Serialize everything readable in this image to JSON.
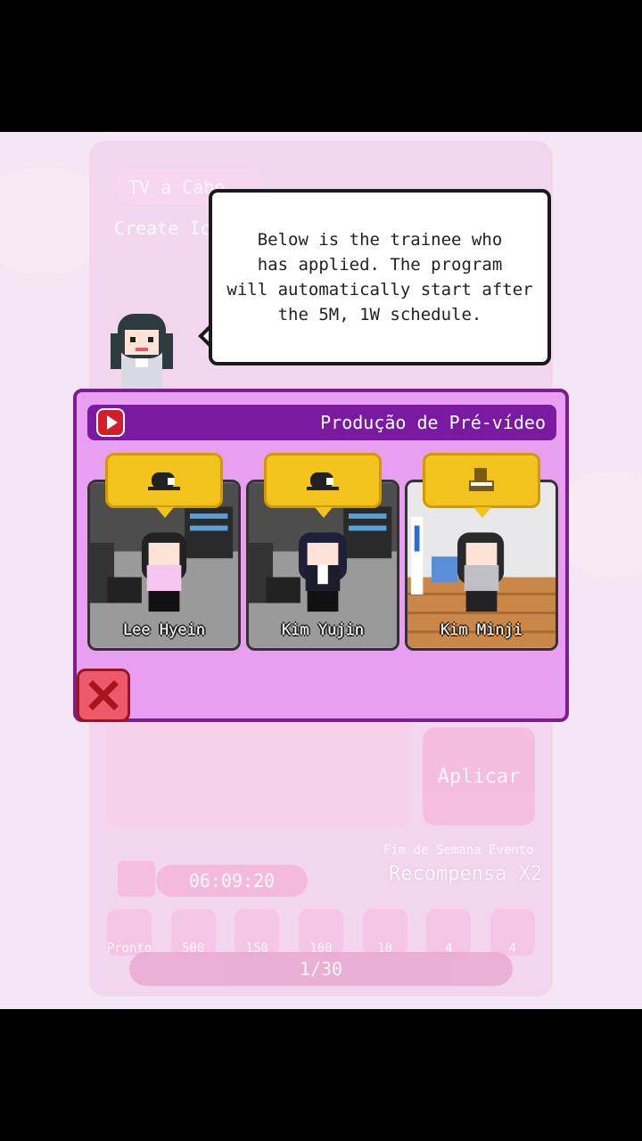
{
  "background": {
    "tv_label": "TV a Cabo",
    "subtitle": "Create Ic",
    "apply_button": "Aplicar",
    "event_label": "Fim de Semana Evento",
    "reward_label": "Recompensa X2",
    "timer": "06:09:20",
    "rewards": [
      {
        "label": "Pronto"
      },
      {
        "label": "500"
      },
      {
        "label": "150"
      },
      {
        "label": "100"
      },
      {
        "label": "10"
      },
      {
        "label": "4"
      },
      {
        "label": "4"
      }
    ],
    "progress": "1/30"
  },
  "bubble": {
    "text": "Below is the trainee who\nhas applied. The program\nwill automatically start after\nthe 5M, 1W schedule."
  },
  "dialog": {
    "title": "Produção de Pré-vídeo",
    "trainees": [
      {
        "name": "Lee Hyein",
        "tag_icon": "studio-camera-icon",
        "scene": "studio"
      },
      {
        "name": "Kim Yujin",
        "tag_icon": "studio-camera-icon",
        "scene": "studio"
      },
      {
        "name": "Kim Minji",
        "tag_icon": "piano-icon",
        "scene": "practice-room"
      }
    ]
  },
  "colors": {
    "dialog_bg": "#e99ff1",
    "header_bg": "#7a1aa0",
    "tag_bg": "#f2c31c",
    "close_bg": "#ef5a6a"
  }
}
